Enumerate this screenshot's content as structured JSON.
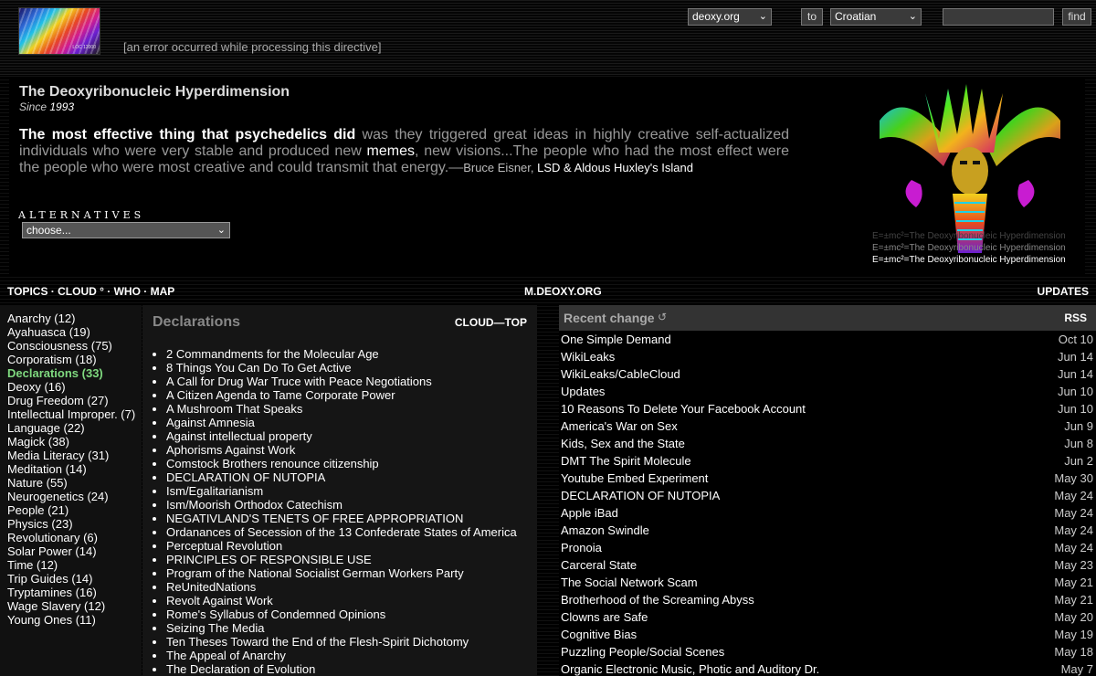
{
  "header": {
    "logo_text": "LOC 12000",
    "error_text": "[an error occurred while processing this directive]",
    "domain_select": "deoxy.org",
    "to_label": "to",
    "language_select": "Croatian",
    "search_value": "",
    "find_label": "find"
  },
  "hero": {
    "title": "The Deoxyribonucleic Hyperdimension",
    "since_label": "Since",
    "since_year": "1993",
    "quote": {
      "strong": "The most effective thing that psychedelics did",
      "part1": " was they triggered great ideas in highly creative self-actualized individuals who were very stable and produced new ",
      "memes": "memes",
      "part2": ", new visions...The people who had the most effect were the people who were most creative and could transmit that energy.",
      "dash": "—",
      "author": "Bruce Eisner, ",
      "source": "LSD & Aldous Huxley's Island"
    },
    "alternatives_label": "ALTERNATIVES",
    "alternatives_select": "choose...",
    "art_captions": [
      "E=±mc²=The Deoxyribonucleic Hyperdimension",
      "E=±mc²=The Deoxyribonucleic Hyperdimension",
      "E=±mc²=The Deoxyribonucleic Hyperdimension"
    ]
  },
  "nav": {
    "topics": "TOPICS",
    "cloud": "CLOUD °",
    "who": "WHO",
    "map": "MAP",
    "sep": " · ",
    "mobile": "M.DEOXY.ORG",
    "updates": "UPDATES"
  },
  "topics": [
    {
      "label": "Anarchy (12)",
      "active": false
    },
    {
      "label": "Ayahuasca (19)",
      "active": false
    },
    {
      "label": "Consciousness (75)",
      "active": false
    },
    {
      "label": "Corporatism (18)",
      "active": false
    },
    {
      "label": "Declarations (33)",
      "active": true
    },
    {
      "label": "Deoxy (16)",
      "active": false
    },
    {
      "label": "Drug Freedom (27)",
      "active": false
    },
    {
      "label": "Intellectual Improper. (7)",
      "active": false
    },
    {
      "label": "Language (22)",
      "active": false
    },
    {
      "label": "Magick (38)",
      "active": false
    },
    {
      "label": "Media Literacy (31)",
      "active": false
    },
    {
      "label": "Meditation (14)",
      "active": false
    },
    {
      "label": "Nature (55)",
      "active": false
    },
    {
      "label": "Neurogenetics (24)",
      "active": false
    },
    {
      "label": "People (21)",
      "active": false
    },
    {
      "label": "Physics (23)",
      "active": false
    },
    {
      "label": "Revolutionary (6)",
      "active": false
    },
    {
      "label": "Solar Power (14)",
      "active": false
    },
    {
      "label": "Time (12)",
      "active": false
    },
    {
      "label": "Trip Guides (14)",
      "active": false
    },
    {
      "label": "Tryptamines (16)",
      "active": false
    },
    {
      "label": "Wage Slavery (12)",
      "active": false
    },
    {
      "label": "Young Ones (11)",
      "active": false
    }
  ],
  "declarations": {
    "title": "Declarations",
    "nav": "CLOUD—TOP",
    "items": [
      "2 Commandments for the Molecular Age",
      "8 Things You Can Do To Get Active",
      "A Call for Drug War Truce with Peace Negotiations",
      "A Citizen Agenda to Tame Corporate Power",
      "A Mushroom That Speaks",
      "Against Amnesia",
      "Against intellectual property",
      "Aphorisms Against Work",
      "Comstock Brothers renounce citizenship",
      "DECLARATION OF NUTOPIA",
      "Ism/Egalitarianism",
      "Ism/Moorish Orthodox Catechism",
      "NEGATIVLAND'S TENETS OF FREE APPROPRIATION",
      "Ordanances of Secession of the 13 Confederate States of America",
      "Perceptual Revolution",
      "PRINCIPLES OF RESPONSIBLE USE",
      "Program of the National Socialist German Workers Party",
      "ReUnitedNations",
      "Revolt Against Work",
      "Rome's Syllabus of Condemned Opinions",
      "Seizing The Media",
      "Ten Theses Toward the End of the Flesh-Spirit Dichotomy",
      "The Appeal of Anarchy",
      "The Declaration of Evolution"
    ]
  },
  "recent": {
    "title": "Recent change",
    "refresh_icon": "↺",
    "rss": "RSS",
    "items": [
      {
        "title": "One Simple Demand",
        "date": "Oct 10"
      },
      {
        "title": "WikiLeaks",
        "date": "Jun 14"
      },
      {
        "title": "WikiLeaks/CableCloud",
        "date": "Jun 14"
      },
      {
        "title": "Updates",
        "date": "Jun 10"
      },
      {
        "title": "10 Reasons To Delete Your Facebook Account",
        "date": "Jun 10"
      },
      {
        "title": "America's War on Sex",
        "date": "Jun 9"
      },
      {
        "title": "Kids, Sex and the State",
        "date": "Jun 8"
      },
      {
        "title": "DMT The Spirit Molecule",
        "date": "Jun 2"
      },
      {
        "title": "Youtube Embed Experiment",
        "date": "May 30"
      },
      {
        "title": "DECLARATION OF NUTOPIA",
        "date": "May 24"
      },
      {
        "title": "Apple iBad",
        "date": "May 24"
      },
      {
        "title": "Amazon Swindle",
        "date": "May 24"
      },
      {
        "title": "Pronoia",
        "date": "May 24"
      },
      {
        "title": "Carceral State",
        "date": "May 23"
      },
      {
        "title": "The Social Network Scam",
        "date": "May 21"
      },
      {
        "title": "Brotherhood of the Screaming Abyss",
        "date": "May 21"
      },
      {
        "title": "Clowns are Safe",
        "date": "May 20"
      },
      {
        "title": "Cognitive Bias",
        "date": "May 19"
      },
      {
        "title": "Puzzling People/Social Scenes",
        "date": "May 18"
      },
      {
        "title": "Organic Electronic Music, Photic and Auditory Dr.",
        "date": "May 7"
      }
    ]
  }
}
